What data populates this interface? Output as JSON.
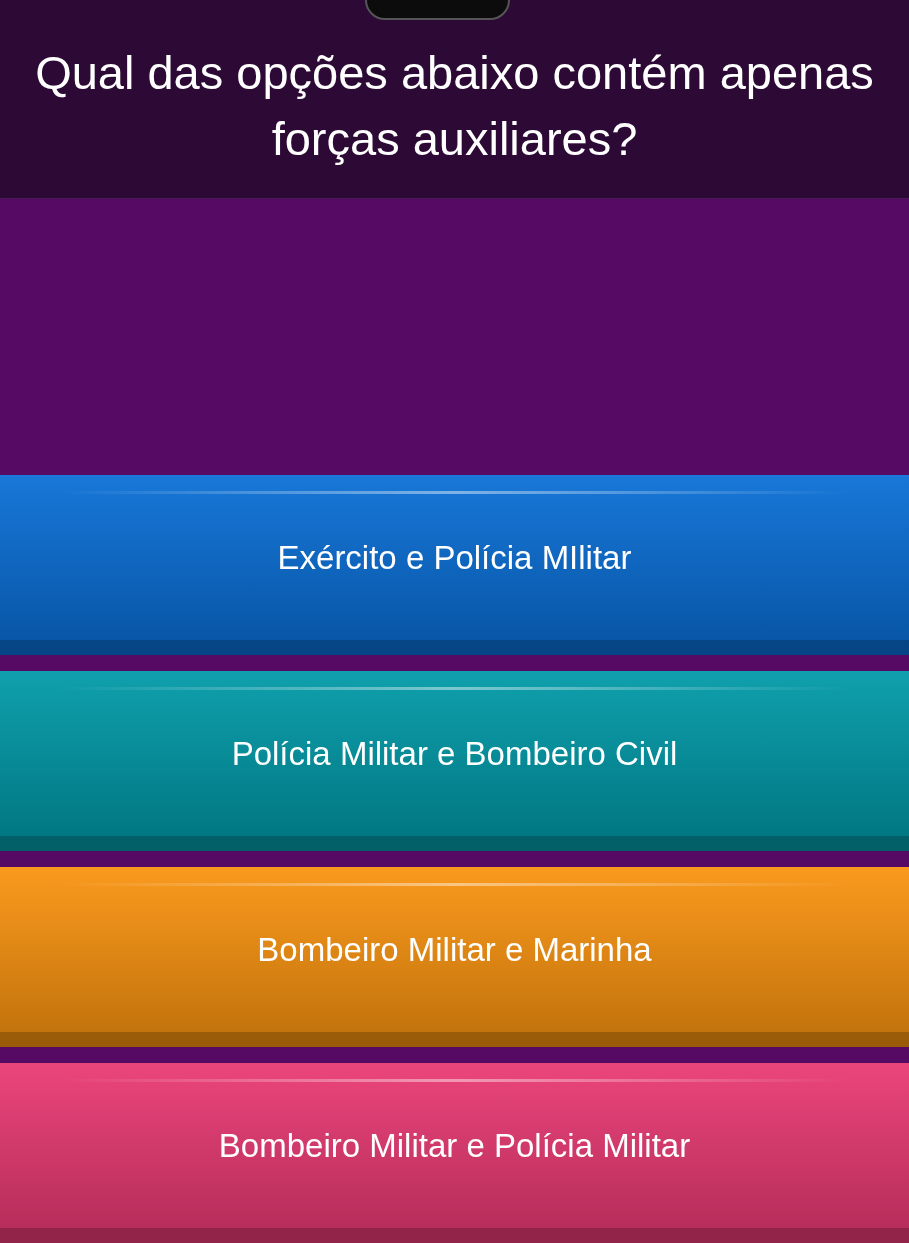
{
  "question": "Qual das opções abaixo contém apenas forças auxiliares?",
  "options": [
    {
      "label": "Exército e Polícia MIlitar",
      "color": "#0a6fd6"
    },
    {
      "label": "Polícia Militar e Bombeiro Civil",
      "color": "#019aa8"
    },
    {
      "label": "Bombeiro Militar e Marinha",
      "color": "#fa9410"
    },
    {
      "label": "Bombeiro Militar e Polícia Militar",
      "color": "#ea3a74"
    }
  ]
}
